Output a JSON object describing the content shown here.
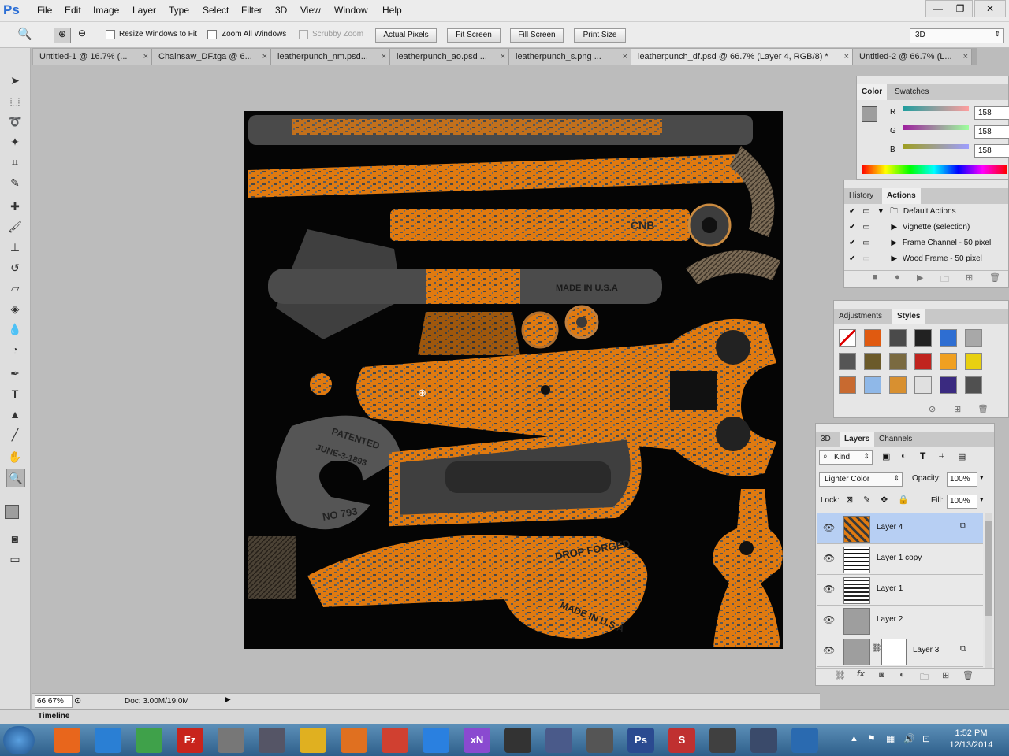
{
  "app": {
    "logo": "Ps"
  },
  "menu": [
    "File",
    "Edit",
    "Image",
    "Layer",
    "Type",
    "Select",
    "Filter",
    "3D",
    "View",
    "Window",
    "Help"
  ],
  "window_controls": {
    "minimize": "—",
    "restore": "❐",
    "close": "✕"
  },
  "options": {
    "resize_windows": "Resize Windows to Fit",
    "zoom_all": "Zoom All Windows",
    "scrubby": "Scrubby Zoom",
    "actual_pixels": "Actual Pixels",
    "fit_screen": "Fit Screen",
    "fill_screen": "Fill Screen",
    "print_size": "Print Size",
    "workspace": "3D"
  },
  "tabs": [
    "Untitled-1 @ 16.7% (...",
    "Chainsaw_DF.tga @ 6...",
    "leatherpunch_nm.psd...",
    "leatherpunch_ao.psd ...",
    "leatherpunch_s.png ...",
    "leatherpunch_df.psd @ 66.7% (Layer 4, RGB/8) *",
    "Untitled-2 @ 66.7% (L..."
  ],
  "tab_close": "×",
  "canvas_text": {
    "made_usa_1": "MADE IN U.S.A",
    "patented": "PATENTED",
    "june": "JUNE-3-1893",
    "no": "NO 793",
    "drop_forged": "DROP FORGED",
    "made_usa_2": "MADE IN U.S.A",
    "cnb": "CNB"
  },
  "status": {
    "zoom": "66.67%",
    "doc": "Doc: 3.00M/19.0M"
  },
  "timeline": "Timeline",
  "color_panel": {
    "tabs": [
      "Color",
      "Swatches"
    ],
    "channels": [
      {
        "label": "R",
        "value": "158"
      },
      {
        "label": "G",
        "value": "158"
      },
      {
        "label": "B",
        "value": "158"
      }
    ],
    "swatch": "#9e9e9e"
  },
  "history_panel": {
    "tabs": [
      "History",
      "Actions"
    ],
    "rows": [
      "Default Actions",
      "Vignette (selection)",
      "Frame Channel - 50 pixel",
      "Wood Frame - 50 pixel"
    ]
  },
  "styles_panel": {
    "tabs": [
      "Adjustments",
      "Styles"
    ],
    "swatches": [
      "#ffffff",
      "#e05a10",
      "#4a4a4a",
      "#222222",
      "#2e6ed2",
      "#a8a8a8",
      "#555555",
      "#6b5a2a",
      "#7a6a40",
      "#c0241f",
      "#f0a020",
      "#e8d010",
      "#c86a30",
      "#8fb8e8",
      "#d89030",
      "#e0e0e0",
      "#3a2a80",
      "#505050"
    ]
  },
  "layers_panel": {
    "tabs": [
      "3D",
      "Layers",
      "Channels"
    ],
    "kind": "Kind",
    "blend_mode": "Lighter Color",
    "opacity_label": "Opacity:",
    "opacity": "100%",
    "lock_label": "Lock:",
    "fill_label": "Fill:",
    "fill": "100%",
    "layers": [
      {
        "name": "Layer 4",
        "selected": true
      },
      {
        "name": "Layer 1 copy",
        "selected": false
      },
      {
        "name": "Layer 1",
        "selected": false
      },
      {
        "name": "Layer 2",
        "selected": false
      },
      {
        "name": "Layer 3",
        "selected": false
      }
    ]
  },
  "taskbar": {
    "icons": [
      "firefox-icon",
      "ie-icon",
      "chrome-icon",
      "filezilla-icon",
      "app-icon",
      "app-icon",
      "explorer-icon",
      "media-icon",
      "app-icon",
      "dropbox-icon",
      "xnview-icon",
      "app-icon",
      "app-icon",
      "zbrush-icon",
      "photoshop-icon",
      "substance-icon",
      "app-icon",
      "app-icon",
      "app-icon"
    ],
    "labels": [
      "",
      "",
      "",
      "Fz",
      "",
      "",
      "",
      "",
      "",
      "",
      "xN",
      "",
      "",
      "",
      "Ps",
      "S",
      "",
      "",
      ""
    ],
    "time": "1:52 PM",
    "date": "12/13/2014"
  }
}
